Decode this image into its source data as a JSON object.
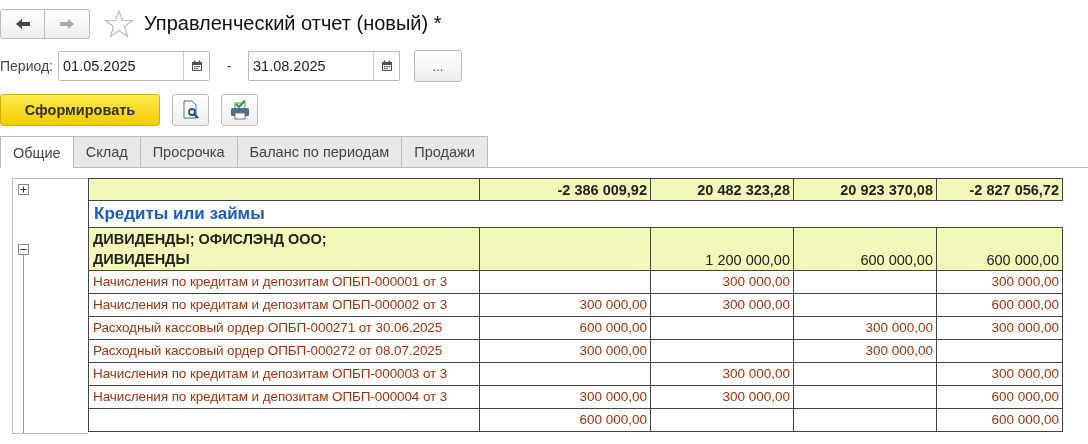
{
  "window": {
    "title": "Управленческий отчет (новый) *",
    "favorite": false
  },
  "period": {
    "label": "Период:",
    "from": "01.05.2025",
    "separator": "-",
    "to": "31.08.2025",
    "more_button": "..."
  },
  "actions": {
    "generate_button": "Сформировать"
  },
  "tabs": [
    {
      "label": "Общие",
      "selected": true
    },
    {
      "label": "Склад",
      "selected": false
    },
    {
      "label": "Просрочка",
      "selected": false
    },
    {
      "label": "Баланс по периодам",
      "selected": false
    },
    {
      "label": "Продажи",
      "selected": false
    }
  ],
  "report": {
    "summary_row": {
      "expanded": false,
      "column_2": "-2 386 009,92",
      "column_3": "20 482 323,28",
      "column_4": "20 923 370,08",
      "column_5": "-2 827 056,72"
    },
    "section_title": "Кредиты или займы",
    "groups": [
      {
        "title": "ДИВИДЕНДЫ; ОФИСЛЭНД ООО; ДИВИДЕНДЫ",
        "expanded": true,
        "column_3": "1 200 000,00",
        "column_4": "600 000,00",
        "column_5": "600 000,00",
        "rows": [
          {
            "label": "Начисления по кредитам и депозитам ОПБП-000001 от 3",
            "column_3": "300 000,00",
            "column_5": "300 000,00"
          },
          {
            "label": "Начисления по кредитам и депозитам ОПБП-000002 от 3",
            "column_2": "300 000,00",
            "column_3": "300 000,00",
            "column_5": "600 000,00"
          },
          {
            "label": "Расходный кассовый ордер ОПБП-000271 от 30.06.2025",
            "column_2": "600 000,00",
            "column_4": "300 000,00",
            "column_5": "300 000,00"
          },
          {
            "label": "Расходный кассовый ордер ОПБП-000272 от 08.07.2025",
            "column_2": "300 000,00",
            "column_4": "300 000,00"
          },
          {
            "label": "Начисления по кредитам и депозитам ОПБП-000003 от 3",
            "column_3": "300 000,00",
            "column_5": "300 000,00"
          },
          {
            "label": "Начисления по кредитам и депозитам ОПБП-000004 от 3",
            "column_2": "300 000,00",
            "column_3": "300 000,00",
            "column_5": "600 000,00"
          },
          {
            "column_2": "600 000,00",
            "column_5": "600 000,00"
          }
        ]
      }
    ]
  }
}
